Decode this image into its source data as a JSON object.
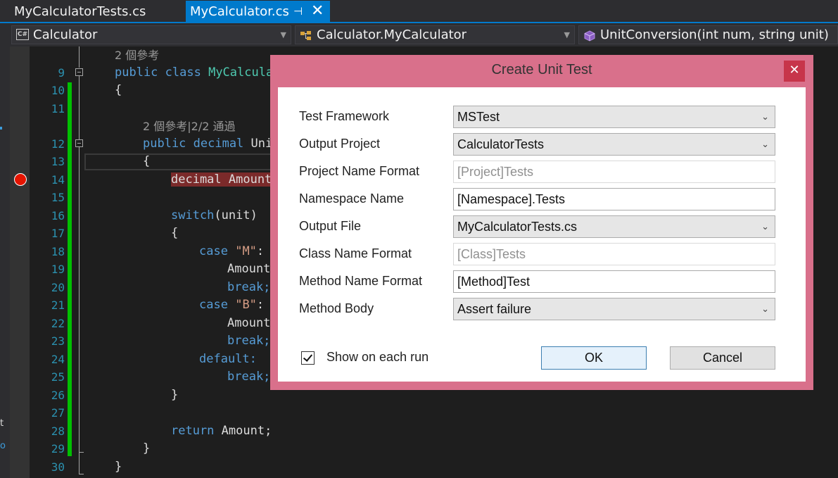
{
  "tabs": [
    {
      "label": "MyCalculatorTests.cs"
    },
    {
      "label": "MyCalculator.cs",
      "pin": "⊣",
      "close": "✕"
    }
  ],
  "navbar": {
    "project": {
      "icon": "csharp-project-icon",
      "icon_text": "C#",
      "label": "Calculator"
    },
    "type": {
      "icon": "class-icon",
      "label": "Calculator.MyCalculator"
    },
    "member": {
      "icon": "method-icon",
      "label": "UnitConversion(int num, string unit)"
    }
  },
  "editor": {
    "line_numbers": [
      "9",
      "10",
      "11",
      "12",
      "13",
      "14",
      "15",
      "16",
      "17",
      "18",
      "19",
      "20",
      "21",
      "22",
      "23",
      "24",
      "25",
      "26",
      "27",
      "28",
      "29",
      "30"
    ],
    "codelens_class": "2 個參考",
    "codelens_method": "2 個參考|2/2 通過",
    "code": {
      "l9_kw": "public class",
      "l9_name": "MyCalcula",
      "l10": "{",
      "l12_kw": "public decimal",
      "l12_rest": "Uni",
      "l13": "{",
      "l14": "decimal Amount",
      "l16_kw": "switch",
      "l16_rest": "(unit)",
      "l17": "{",
      "l18_kw": "case",
      "l18_str": "\"M\"",
      "l18_rest": ":",
      "l19": "Amount",
      "l20": "break;",
      "l21_kw": "case",
      "l21_str": "\"B\"",
      "l21_rest": ":",
      "l22": "Amount",
      "l23": "break;",
      "l24": "default:",
      "l25": "break;",
      "l26": "}",
      "l28_kw": "return",
      "l28_rest": "Amount;",
      "l29": "}",
      "l30": "}"
    },
    "left_fragments": [
      "t",
      "o"
    ]
  },
  "dialog": {
    "title": "Create Unit Test",
    "close": "✕",
    "fields": {
      "test_framework": {
        "label": "Test Framework",
        "value": "MSTest"
      },
      "output_project": {
        "label": "Output Project",
        "value": "CalculatorTests"
      },
      "project_name_format": {
        "label": "Project Name Format",
        "value": "[Project]Tests"
      },
      "namespace_name": {
        "label": "Namespace Name",
        "value": "[Namespace].Tests"
      },
      "output_file": {
        "label": "Output File",
        "value": "MyCalculatorTests.cs"
      },
      "class_name_format": {
        "label": "Class Name Format",
        "value": "[Class]Tests"
      },
      "method_name_format": {
        "label": "Method Name Format",
        "value": "[Method]Test"
      },
      "method_body": {
        "label": "Method Body",
        "value": "Assert failure"
      }
    },
    "dropdown_chevron": "⌄",
    "show_on_each_run": {
      "label": "Show on each run",
      "checked": true
    },
    "ok_label": "OK",
    "cancel_label": "Cancel"
  },
  "colors": {
    "accent": "#007acc",
    "dialog_frame": "#d9708b",
    "dialog_close": "#c7354a",
    "breakpoint": "#e51400",
    "change_bar": "#00c000"
  }
}
